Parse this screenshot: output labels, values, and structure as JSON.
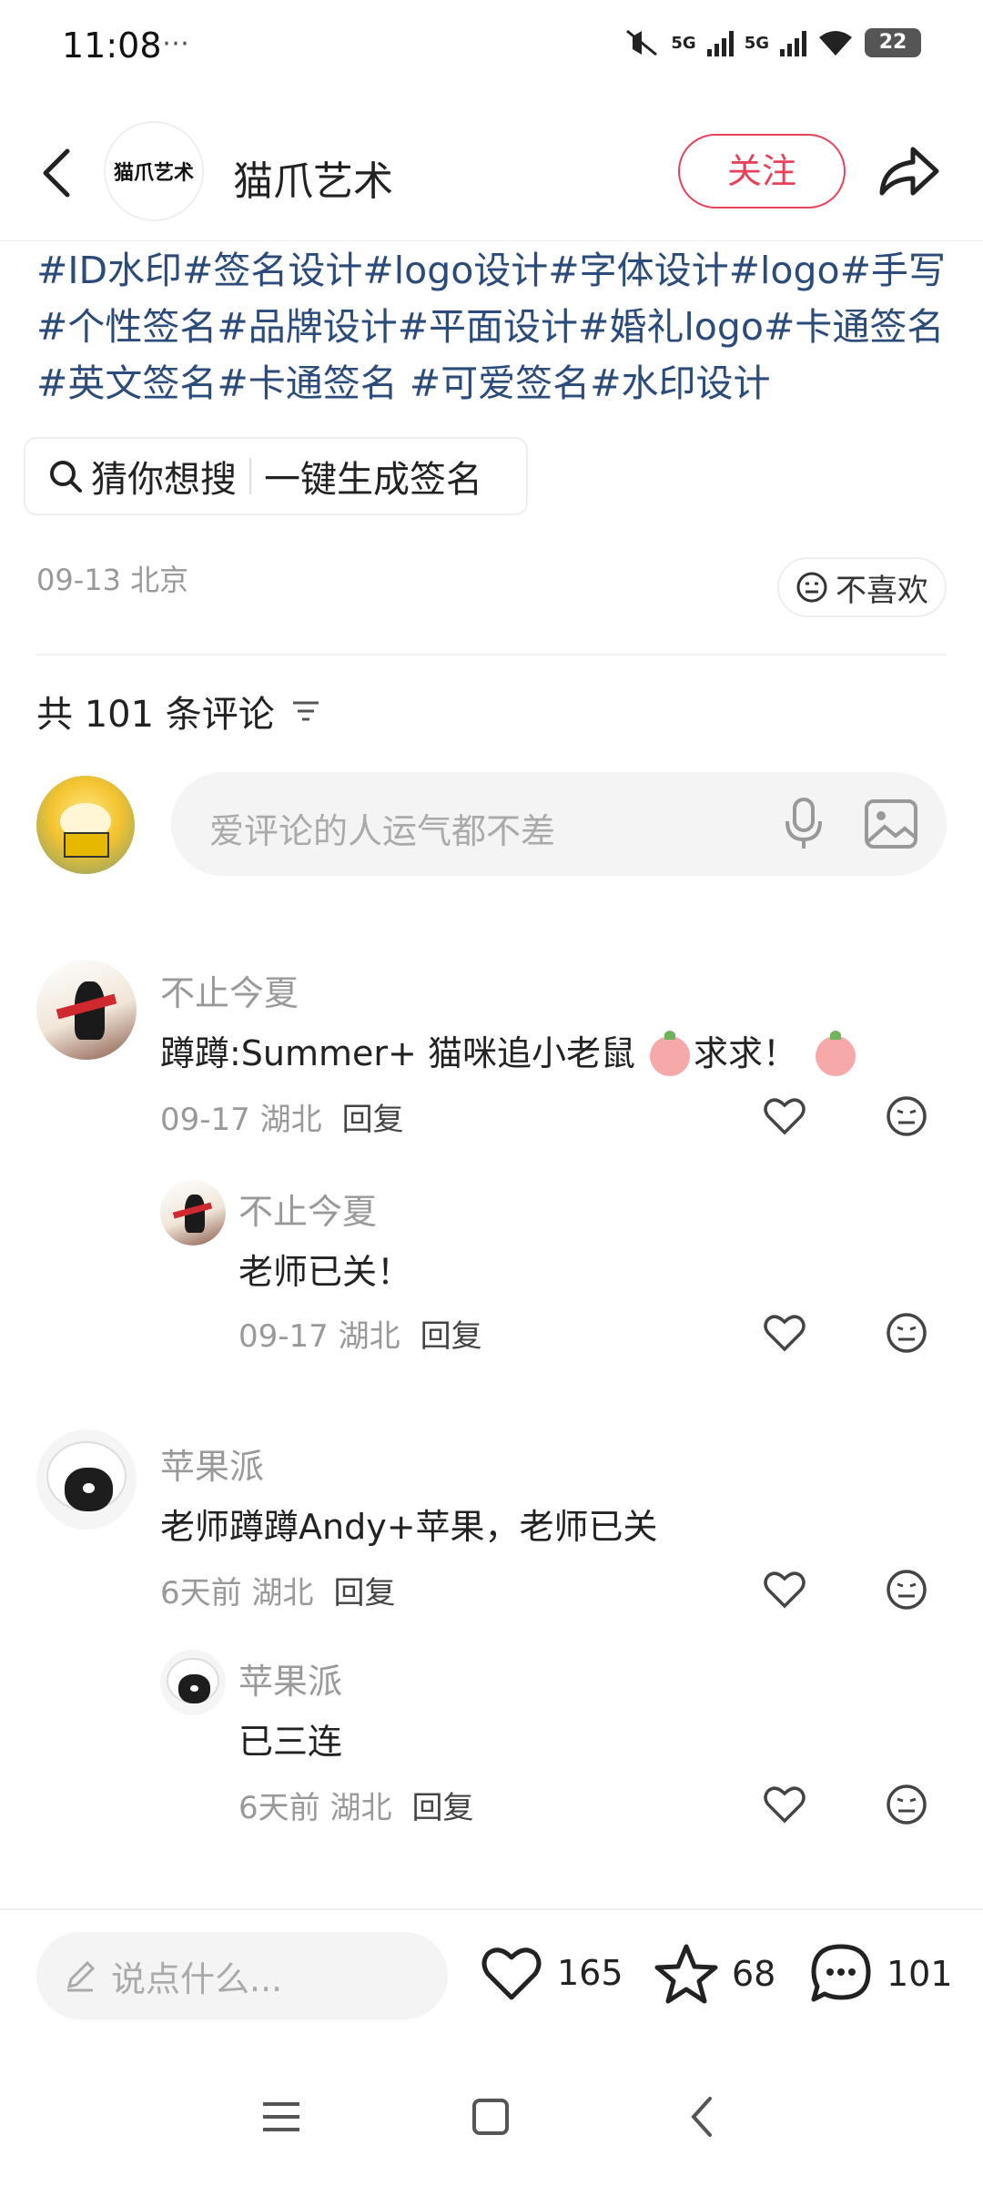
{
  "status_bar": {
    "time": "11:08",
    "extra": "⋯",
    "signal1": "5G",
    "signal2": "5G",
    "battery": "22"
  },
  "header": {
    "author_name": "猫爪艺术",
    "avatar_text": "猫爪艺术",
    "follow_label": "关注"
  },
  "post": {
    "tags_text": "#ID水印#签名设计#logo设计#字体设计#logo#手写#个性签名#品牌设计#平面设计#婚礼logo#卡通签名#英文签名#卡通签名 #可爱签名#水印设计",
    "search_prefix": "猜你想搜",
    "search_suggestion": "一键生成签名",
    "meta": "09-13 北京",
    "dislike_label": "不喜欢"
  },
  "comments_section": {
    "count_label": "共 101 条评论",
    "input_placeholder": "爱评论的人运气都不差"
  },
  "comments": [
    {
      "name": "不止今夏",
      "text_a": "蹲蹲:Summer+ 猫咪追小老鼠 ",
      "text_b": "求求！",
      "time": "09-17 湖北",
      "reply": "回复",
      "replies": [
        {
          "name": "不止今夏",
          "text": "老师已关！",
          "time": "09-17 湖北",
          "reply": "回复"
        }
      ]
    },
    {
      "name": "苹果派",
      "text": "老师蹲蹲Andy+苹果，老师已关",
      "time": "6天前 湖北",
      "reply": "回复",
      "replies": [
        {
          "name": "苹果派",
          "text": "已三连",
          "time": "6天前 湖北",
          "reply": "回复"
        }
      ]
    }
  ],
  "bottom_bar": {
    "say_placeholder": "说点什么...",
    "likes": "165",
    "stars": "68",
    "comments": "101"
  },
  "colors": {
    "accent": "#e8425a",
    "tag": "#2b4b7a",
    "muted": "#999999"
  }
}
